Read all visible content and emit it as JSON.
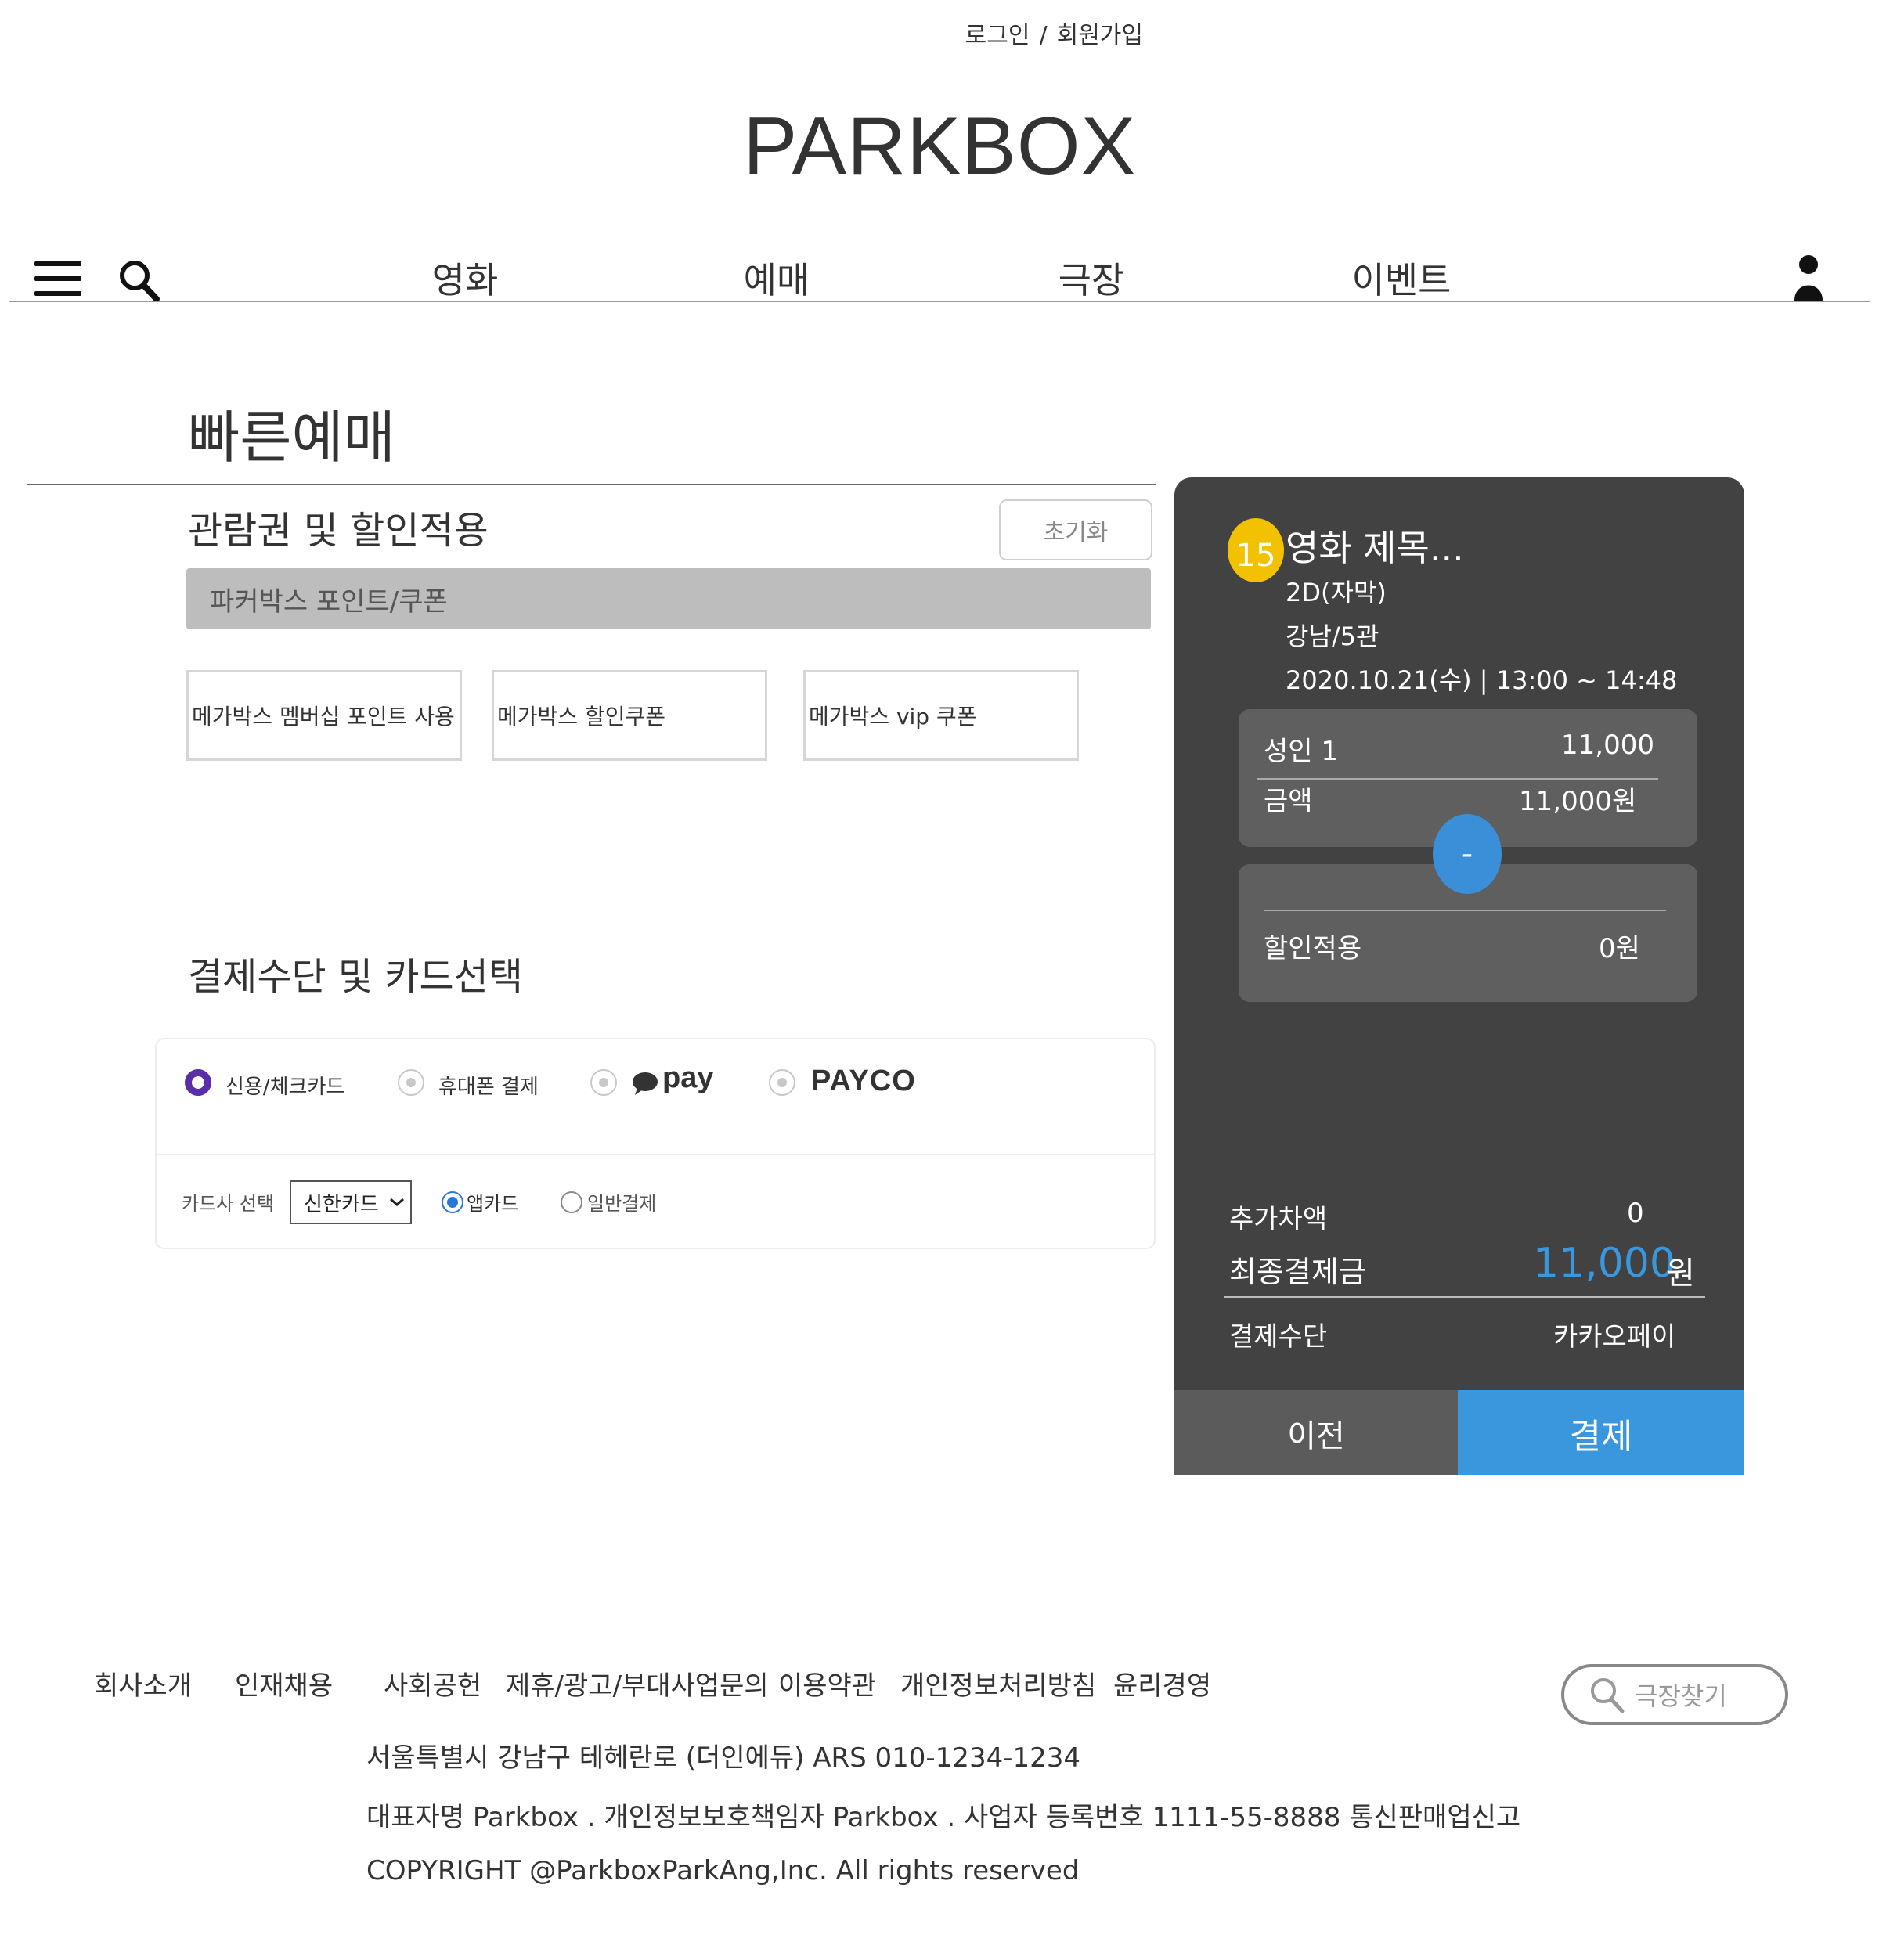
{
  "header": {
    "login": "로그인",
    "separator": "/",
    "signup": "회원가입",
    "logo": "PARKBOX"
  },
  "nav": {
    "items": [
      "영화",
      "예매",
      "극장",
      "이벤트"
    ]
  },
  "page": {
    "title": "빠른예매"
  },
  "discount": {
    "title": "관람권 및 할인적용",
    "reset": "초기화",
    "bar_label": "파커박스 포인트/쿠폰",
    "options": [
      "메가박스 멤버십 포인트 사용",
      "메가박스 할인쿠폰",
      "메가박스 vip 쿠폰"
    ]
  },
  "payment": {
    "title": "결제수단 및 카드선택",
    "methods": [
      "신용/체크카드",
      "휴대폰 결제",
      "pay",
      "PAYCO"
    ],
    "selected_method": "신용/체크카드",
    "card_label": "카드사 선택",
    "card_value": "신한카드",
    "card_modes": [
      "앱카드",
      "일반결제"
    ],
    "selected_mode": "앱카드",
    "accent_color": "#5a2ea6"
  },
  "summary": {
    "rating": "15",
    "movie_title": "영화 제목...",
    "format": "2D(자막)",
    "theater": "강남/5관",
    "datetime": "2020.10.21(수) | 13:00 ~ 14:48",
    "adult_label": "성인 1",
    "adult_price": "11,000",
    "amount_label": "금액",
    "amount_value": "11,000원",
    "minus": "-",
    "discount_label": "할인적용",
    "discount_value": "0원",
    "extra_label": "추가차액",
    "extra_value": "0",
    "final_label": "최종결제금",
    "final_value": "11,000",
    "final_unit": "원",
    "method_label": "결제수단",
    "method_value": "카카오페이",
    "prev_button": "이전",
    "pay_button": "결제",
    "accent_color": "#3a97de",
    "rating_color": "#f2c200"
  },
  "footer": {
    "links": [
      "회사소개",
      "인재채용",
      "사회공헌",
      "제휴/광고/부대사업문의",
      "이용약관",
      "개인정보처리방침",
      "윤리경영"
    ],
    "address": "서울특별시 강남구 테헤란로 (더인에듀) ARS 010-1234-1234",
    "company_info": "대표자명 Parkbox . 개인정보보호책임자 Parkbox . 사업자 등록번호 1111-55-8888 통신판매업신고",
    "copyright": "COPYRIGHT @ParkboxParkAng,Inc. All rights reserved",
    "find_theater": "극장찾기"
  },
  "icons": {
    "menu": "hamburger-menu-icon",
    "search": "search-icon",
    "user": "user-icon",
    "kakao": "speech-bubble-icon",
    "chevron": "chevron-down-icon"
  }
}
